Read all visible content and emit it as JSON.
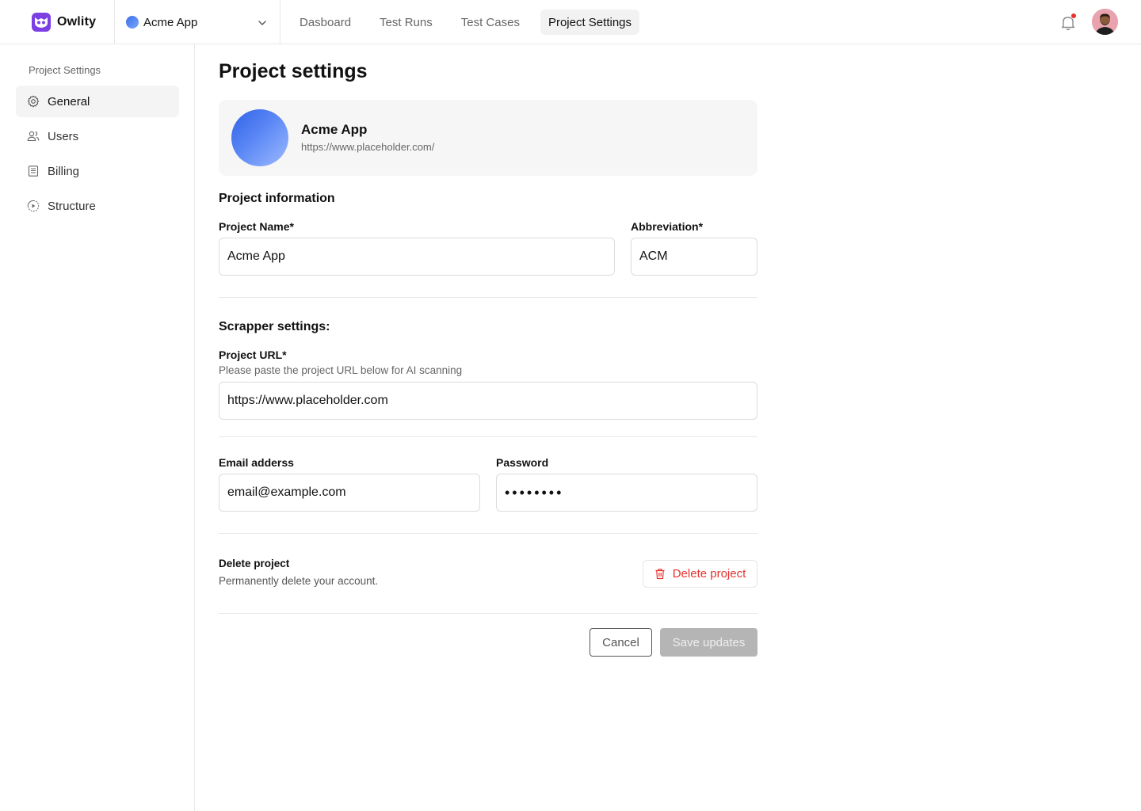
{
  "header": {
    "brand": "Owlity",
    "project_switcher": {
      "name": "Acme App"
    },
    "tabs": [
      {
        "label": "Dasboard",
        "active": false
      },
      {
        "label": "Test Runs",
        "active": false
      },
      {
        "label": "Test Cases",
        "active": false
      },
      {
        "label": "Project Settings",
        "active": true
      }
    ],
    "notification_dot": true
  },
  "sidebar": {
    "title": "Project Settings",
    "items": [
      {
        "label": "General",
        "icon": "gear-icon",
        "active": true
      },
      {
        "label": "Users",
        "icon": "users-icon",
        "active": false
      },
      {
        "label": "Billing",
        "icon": "billing-icon",
        "active": false
      },
      {
        "label": "Structure",
        "icon": "structure-icon",
        "active": false
      }
    ]
  },
  "main": {
    "title": "Project settings",
    "project_card": {
      "name": "Acme App",
      "url": "https://www.placeholder.com/"
    },
    "project_info": {
      "section_title": "Project information",
      "project_name_label": "Project Name*",
      "project_name_value": "Acme App",
      "abbreviation_label": "Abbreviation*",
      "abbreviation_value": "ACM"
    },
    "scrapper": {
      "section_title": "Scrapper settings:",
      "url_label": "Project URL*",
      "url_hint": "Please paste the project URL below for AI scanning",
      "url_value": "https://www.placeholder.com",
      "email_label": "Email adderss",
      "email_value": "email@example.com",
      "password_label": "Password",
      "password_value": "••••••••"
    },
    "delete": {
      "title": "Delete project",
      "description": "Permanently delete your account.",
      "button_label": "Delete project"
    },
    "actions": {
      "cancel_label": "Cancel",
      "save_label": "Save updates"
    }
  },
  "colors": {
    "brand": "#7b3fe4",
    "danger": "#e5322d",
    "disabled_button": "#b5b5b5",
    "project_gradient_start": "#2f62e6",
    "project_gradient_end": "#9dbaff"
  }
}
